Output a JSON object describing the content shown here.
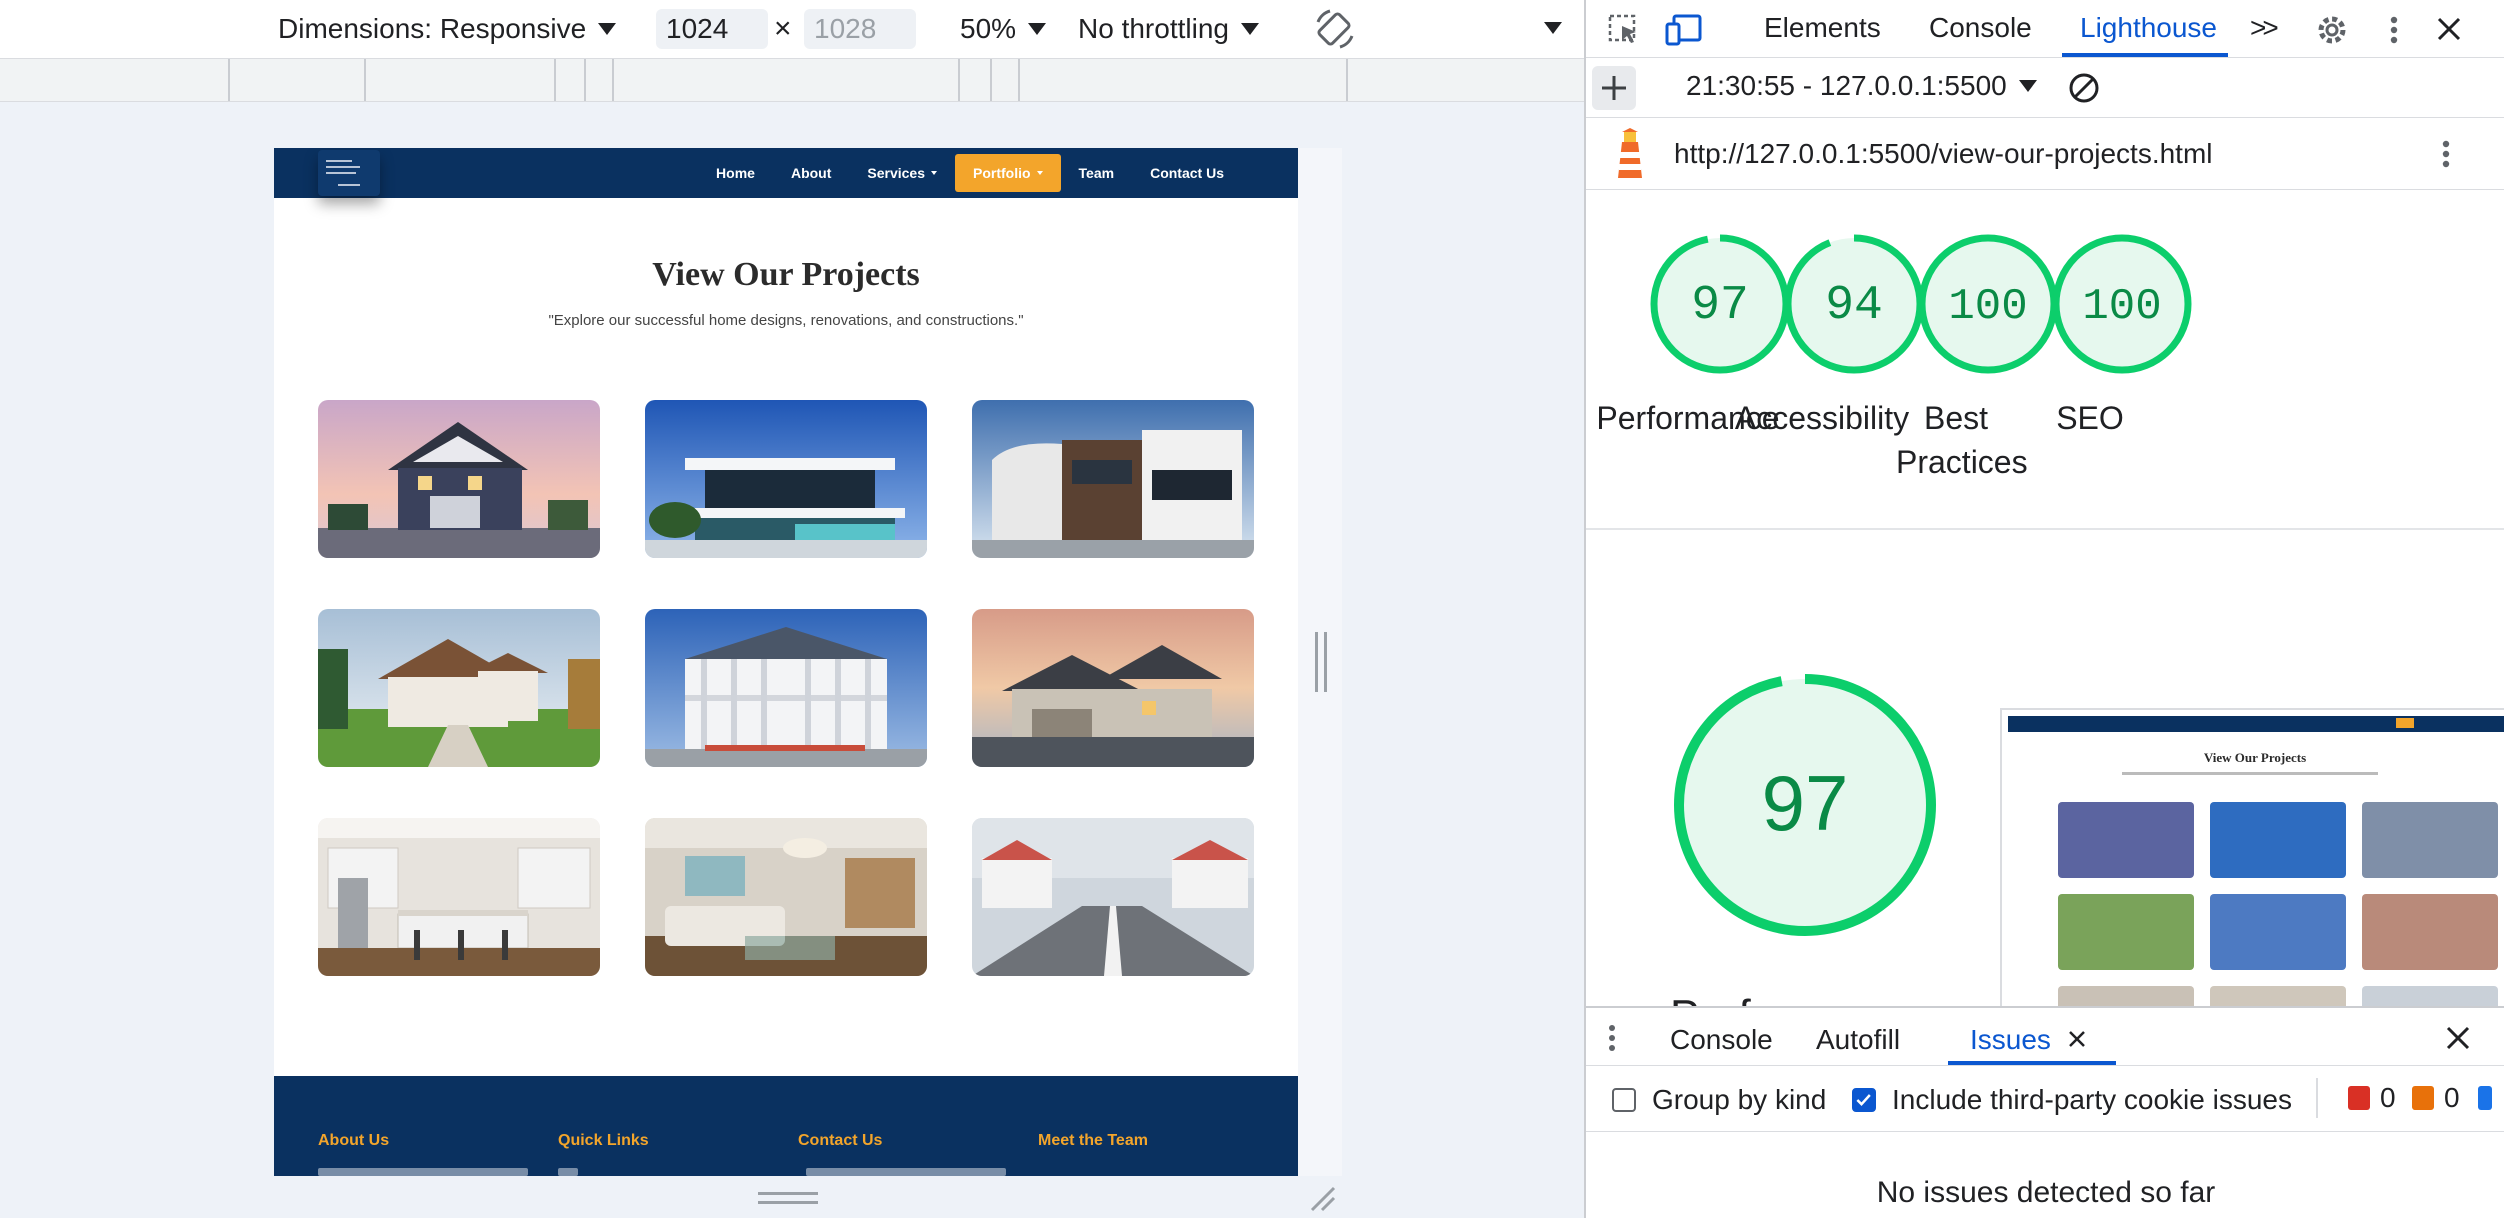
{
  "device_toolbar": {
    "dimensions_label": "Dimensions: Responsive",
    "width_value": "1024",
    "times_sign": "×",
    "height_placeholder": "1028",
    "zoom": "50%",
    "throttling": "No throttling"
  },
  "site": {
    "nav": [
      {
        "label": "Home",
        "has_caret": false,
        "active": false
      },
      {
        "label": "About",
        "has_caret": false,
        "active": false
      },
      {
        "label": "Services",
        "has_caret": true,
        "active": false
      },
      {
        "label": "Portfolio",
        "has_caret": true,
        "active": true
      },
      {
        "label": "Team",
        "has_caret": false,
        "active": false
      },
      {
        "label": "Contact Us",
        "has_caret": false,
        "active": false
      }
    ],
    "title": "View Our Projects",
    "subtitle": "\"Explore our successful home designs, renovations, and constructions.\"",
    "footer_headings": [
      "About Us",
      "Quick Links",
      "Contact Us",
      "Meet the Team"
    ],
    "colors": {
      "navy": "#0a3160",
      "accent": "#f3a52b"
    }
  },
  "devtools": {
    "tabs": [
      "Elements",
      "Console",
      "Lighthouse"
    ],
    "active_tab": "Lighthouse",
    "report_selector": "21:30:55 - 127.0.0.1:5500",
    "url": "http://127.0.0.1:5500/view-our-projects.html",
    "scores": [
      {
        "label": "Performance",
        "value": "97"
      },
      {
        "label": "Accessibility",
        "value": "94"
      },
      {
        "label": "Best Practices",
        "value": "100"
      },
      {
        "label": "SEO",
        "value": "100"
      }
    ],
    "big_score": "97",
    "big_label": "Perf",
    "score_color": "#0cce6b",
    "screenshot_title": "View Our Projects"
  },
  "drawer": {
    "tabs": [
      "Console",
      "Autofill",
      "Issues"
    ],
    "active_tab": "Issues",
    "group_by_kind": "Group by kind",
    "include_third_party": "Include third-party cookie issues",
    "error_count": "0",
    "warning_count": "0",
    "no_issues": "No issues detected so far"
  }
}
